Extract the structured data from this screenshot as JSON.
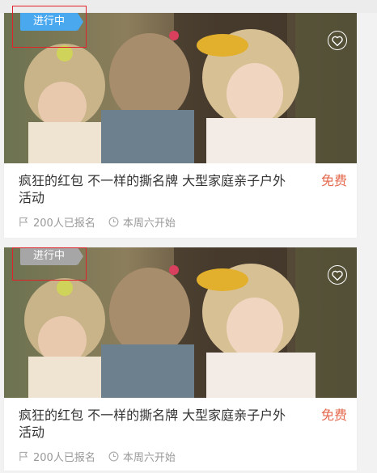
{
  "colors": {
    "status_active_bg": "#4aa8ef",
    "status_inactive_bg": "#a6a6a6",
    "price": "#e4684d",
    "highlight": "#e0222a"
  },
  "cards": [
    {
      "status": "进行中",
      "title": "疯狂的红包 不一样的撕名牌 大型家庭亲子户外活动",
      "price": "免费",
      "signups": "200人已报名",
      "start": "本周六开始"
    },
    {
      "status": "进行中",
      "title": "疯狂的红包 不一样的撕名牌 大型家庭亲子户外活动",
      "price": "免费",
      "signups": "200人已报名",
      "start": "本周六开始"
    }
  ]
}
